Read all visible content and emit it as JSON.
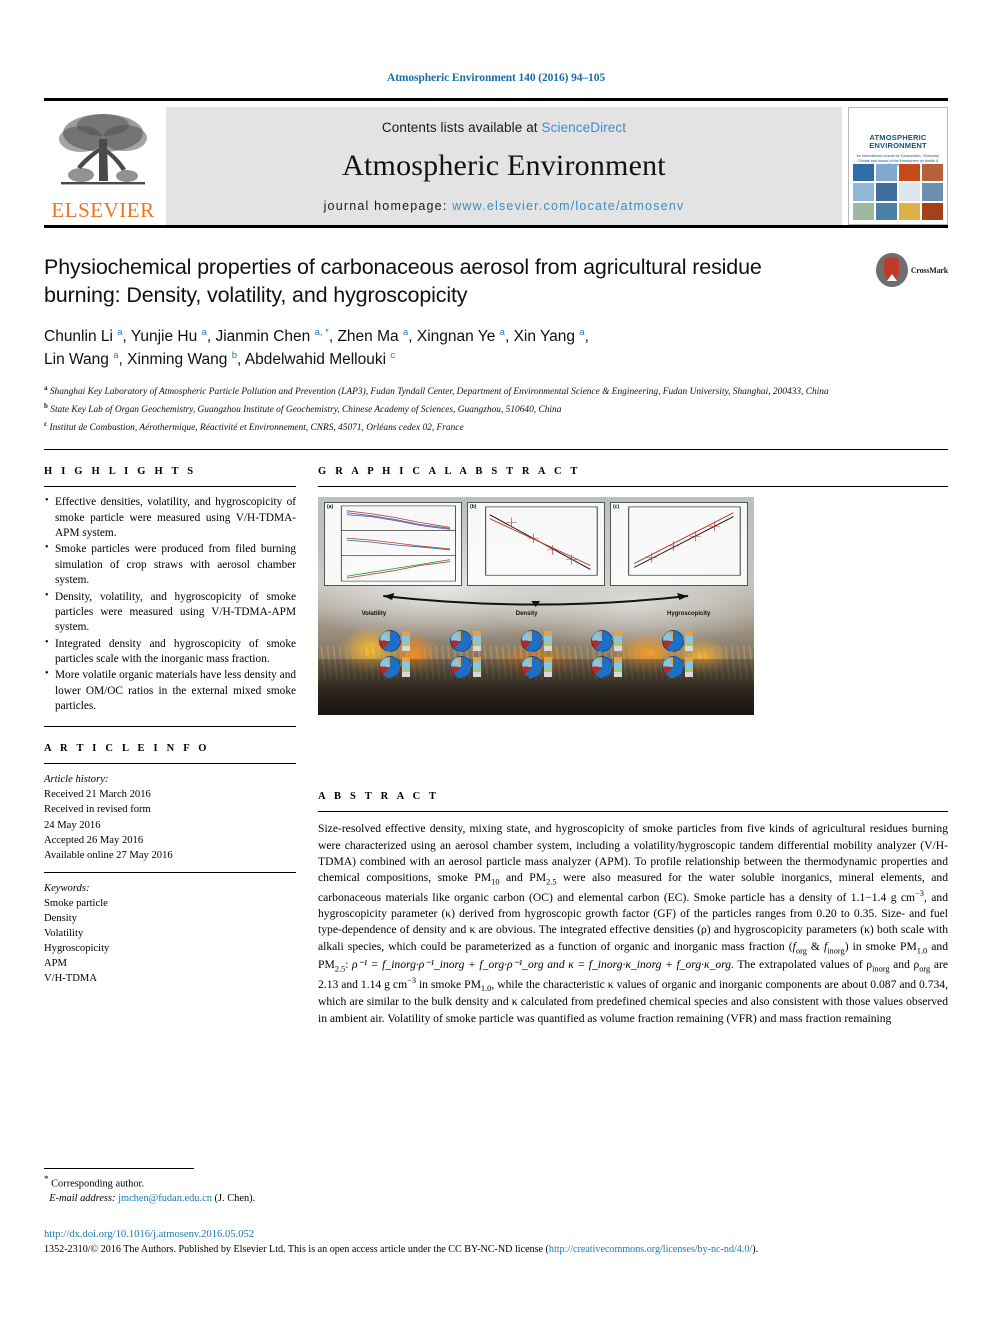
{
  "running_head": "Atmospheric Environment 140 (2016) 94–105",
  "masthead": {
    "contents_prefix": "Contents lists available at ",
    "sciencedirect": "ScienceDirect",
    "journal_name": "Atmospheric Environment",
    "homepage_label": "journal homepage: ",
    "homepage_url": "www.elsevier.com/locate/atmosenv",
    "publisher_logo_text": "ELSEVIER",
    "cover": {
      "title_line1": "ATMOSPHERIC",
      "title_line2": "ENVIRONMENT",
      "subtitle": "An International Journal for Composition, Chemistry, Climate and Impact of the Atmosphere on Health & Ecosystems"
    }
  },
  "article": {
    "title": "Physiochemical properties of carbonaceous aerosol from agricultural residue burning: Density, volatility, and hygroscopicity",
    "crossmark_label": "CrossMark",
    "authors": [
      {
        "name": "Chunlin Li",
        "marks": "a"
      },
      {
        "name": "Yunjie Hu",
        "marks": "a"
      },
      {
        "name": "Jianmin Chen",
        "marks": "a, *"
      },
      {
        "name": "Zhen Ma",
        "marks": "a"
      },
      {
        "name": "Xingnan Ye",
        "marks": "a"
      },
      {
        "name": "Xin Yang",
        "marks": "a"
      },
      {
        "name": "Lin Wang",
        "marks": "a"
      },
      {
        "name": "Xinming Wang",
        "marks": "b"
      },
      {
        "name": "Abdelwahid Mellouki",
        "marks": "c"
      }
    ],
    "affiliations": [
      {
        "mark": "a",
        "text": "Shanghai Key Laboratory of Atmospheric Particle Pollution and Prevention (LAP3), Fudan Tyndall Center, Department of Environmental Science & Engineering, Fudan University, Shanghai, 200433, China"
      },
      {
        "mark": "b",
        "text": "State Key Lab of Organ Geochemistry, Guangzhou Institute of Geochemistry, Chinese Academy of Sciences, Guangzhou, 510640, China"
      },
      {
        "mark": "c",
        "text": "Institut de Combustion, Aérothermique, Réactivité et Environnement, CNRS, 45071, Orléans cedex 02, France"
      }
    ]
  },
  "highlights": {
    "heading": "H I G H L I G H T S",
    "items": [
      "Effective densities, volatility, and hygroscopicity of smoke particle were measured using V/H-TDMA-APM system.",
      "Smoke particles were produced from filed burning simulation of crop straws with aerosol chamber system.",
      "Density, volatility, and hygroscopicity of smoke particles were measured using V/H-TDMA-APM system.",
      "Integrated density and hygroscopicity of smoke particles scale with the inorganic mass fraction.",
      "More volatile organic materials have less density and lower OM/OC ratios in the external mixed smoke particles."
    ]
  },
  "graphical_abstract": {
    "heading": "G R A P H I C A L   A B S T R A C T",
    "panel_labels": [
      "(a)",
      "(b)",
      "(c)"
    ],
    "flow_labels": [
      "Volatility",
      "Density",
      "Hygroscopicity"
    ]
  },
  "article_info": {
    "heading": "A R T I C L E   I N F O",
    "history_label": "Article history:",
    "history": [
      "Received 21 March 2016",
      "Received in revised form",
      "24 May 2016",
      "Accepted 26 May 2016",
      "Available online 27 May 2016"
    ],
    "keywords_label": "Keywords:",
    "keywords": [
      "Smoke particle",
      "Density",
      "Volatility",
      "Hygroscopicity",
      "APM",
      "V/H-TDMA"
    ]
  },
  "abstract": {
    "heading": "A B S T R A C T",
    "paragraph_part1": "Size-resolved effective density, mixing state, and hygroscopicity of smoke particles from five kinds of agricultural residues burning were characterized using an aerosol chamber system, including a volatility/hygroscopic tandem differential mobility analyzer (V/H-TDMA) combined with an aerosol particle mass analyzer (APM). To profile relationship between the thermodynamic properties and chemical compositions, smoke PM",
    "p1_sub1": "10",
    "p1_mid1": " and PM",
    "p1_sub2": "2.5",
    "p1_mid2": " were also measured for the water soluble inorganics, mineral elements, and carbonaceous materials like organic carbon (OC) and elemental carbon (EC). Smoke particle has a density of 1.1−1.4 g cm",
    "p1_sup1": "−3",
    "p1_mid3": ", and hygroscopicity parameter (κ) derived from hygroscopic growth factor (GF) of the particles ranges from 0.20 to 0.35. Size- and fuel type-dependence of density and κ are obvious. The integrated effective densities (ρ) and hygroscopicity parameters (κ) both scale with alkali species, which could be parameterized as a function of organic and inorganic mass fraction (",
    "p1_eq1": "f",
    "p1_eq1_sub": "org",
    "p1_mid4": " & ",
    "p1_eq2": "f",
    "p1_eq2_sub": "inorg",
    "p1_mid5": ") in smoke PM",
    "p1_sub3": "1.0",
    "p1_mid6": " and PM",
    "p1_sub4": "2.5",
    "p1_mid7": ": ",
    "equation": "ρ⁻¹ = f_inorg·ρ⁻¹_inorg + f_org·ρ⁻¹_org and κ = f_inorg·κ_inorg + f_org·κ_org.",
    "p1_tail": " The extrapolated values of ρ",
    "p1_tail_sub1": "inorg",
    "p1_tail2": " and ρ",
    "p1_tail_sub2": "org",
    "p1_tail3": " are 2.13 and 1.14 g cm",
    "p1_tail_sup": "−3",
    "p1_tail4": " in smoke PM",
    "p1_tail_sub3": "1.0",
    "p1_tail5": ", while the characteristic κ values of organic and inorganic components are about 0.087 and 0.734, which are similar to the bulk density and κ calculated from predefined chemical species and also consistent with those values observed in ambient air. Volatility of smoke particle was quantified as volume fraction remaining (VFR) and mass fraction remaining"
  },
  "footer": {
    "corresponding_marker": "*",
    "corresponding_label": "Corresponding author.",
    "email_label": "E-mail address:",
    "email": "jmchen@fudan.edu.cn",
    "email_suffix": "(J. Chen).",
    "doi_url": "http://dx.doi.org/10.1016/j.atmosenv.2016.05.052",
    "copyright_pre": "1352-2310/© 2016 The Authors. Published by Elsevier Ltd. This is an open access article under the CC BY-NC-ND license (",
    "license_url": "http://creativecommons.org/licenses/by-nc-nd/4.0/",
    "copyright_post": ")."
  },
  "colors": {
    "link": "#1a7ab5",
    "accent_blue": "#2878b5",
    "elsevier_orange": "#E87722",
    "masthead_gray": "#e3e3e3"
  }
}
